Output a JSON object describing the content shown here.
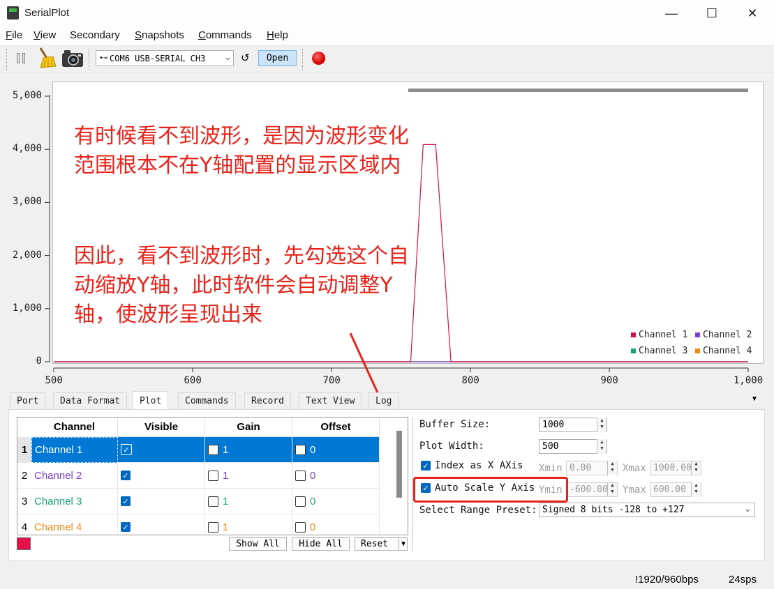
{
  "window": {
    "title": "SerialPlot",
    "minimize": "—",
    "maximize": "☐",
    "close": "✕"
  },
  "menu": [
    {
      "key": "F",
      "rest": "ile"
    },
    {
      "key": "V",
      "rest": "iew"
    },
    {
      "key": "",
      "rest": "Secondary"
    },
    {
      "key": "S",
      "rest": "napshots"
    },
    {
      "key": "C",
      "rest": "ommands"
    },
    {
      "key": "H",
      "rest": "elp"
    }
  ],
  "toolbar": {
    "port": "COM6 USB-SERIAL CH3",
    "refresh": "↺",
    "open_label": "Open",
    "icons": [
      "pause-icon",
      "clear-broom-icon",
      "snapshot-camera-icon",
      "usb-icon",
      "record-icon"
    ]
  },
  "plot": {
    "annotation_1": "有时候看不到波形，是因为波形变化范围根本不在Y轴配置的显示区域内",
    "annotation_2": "因此，看不到波形时，先勾选这个自动缩放Y轴，此时软件会自动调整Y轴，使波形呈现出来"
  },
  "chart_data": {
    "type": "line",
    "title": "",
    "xlabel": "",
    "ylabel": "",
    "xlim": [
      500,
      1000
    ],
    "ylim": [
      0,
      5000
    ],
    "x_ticks": [
      "500",
      "600",
      "700",
      "800",
      "900",
      "1,000"
    ],
    "y_ticks": [
      "0",
      "1,000",
      "2,000",
      "3,000",
      "4,000",
      "5,000"
    ],
    "grid": false,
    "legend_position": "bottom-right",
    "series": [
      {
        "name": "Channel 1",
        "color": "#d0104c",
        "x": [
          500,
          757,
          766,
          775,
          786,
          1000
        ],
        "y": [
          0,
          0,
          4090,
          4090,
          0,
          0
        ]
      },
      {
        "name": "Channel 2",
        "color": "#7a3fd0",
        "x": [
          500,
          1000
        ],
        "y": [
          0,
          0
        ]
      },
      {
        "name": "Channel 3",
        "color": "#1aa37a",
        "x": [
          500,
          1000
        ],
        "y": [
          0,
          0
        ]
      },
      {
        "name": "Channel 4",
        "color": "#f08a10",
        "x": [
          500,
          1000
        ],
        "y": [
          0,
          0
        ]
      }
    ]
  },
  "tabs": [
    "Port",
    "Data Format",
    "Plot",
    "Commands",
    "Record",
    "Text View",
    "Log"
  ],
  "active_tab": "Plot",
  "channel_table": {
    "headers": [
      "Channel",
      "Visible",
      "Gain",
      "Offset"
    ],
    "rows": [
      {
        "num": "1",
        "name": "Channel 1",
        "gain": "1",
        "offset": "0",
        "color": "#d0104c"
      },
      {
        "num": "2",
        "name": "Channel 2",
        "gain": "1",
        "offset": "0",
        "color": "#7a3fd0"
      },
      {
        "num": "3",
        "name": "Channel 3",
        "gain": "1",
        "offset": "0",
        "color": "#1aa37a"
      },
      {
        "num": "4",
        "name": "Channel 4",
        "gain": "1",
        "offset": "0",
        "color": "#f08a10"
      }
    ],
    "swatch_color": "#e8104c",
    "show_all": "Show All",
    "hide_all": "Hide All",
    "reset": "Reset"
  },
  "settings": {
    "buffer_size_label": "Buffer Size:",
    "buffer_size": "1000",
    "plot_width_label": "Plot Width:",
    "plot_width": "500",
    "index_x_label": "Index as X AXis",
    "xmin_label": "Xmin",
    "xmin": "0.00",
    "xmax_label": "Xmax",
    "xmax": "1000.00",
    "auto_scale_label": "Auto Scale Y Axis",
    "ymin_label": "Ymin",
    "ymin": "-600.00",
    "ymax_label": "Ymax",
    "ymax": "600.00",
    "range_preset_label": "Select Range Preset:",
    "range_preset": "Signed 8 bits -128 to +127"
  },
  "status": {
    "rate": "!1920/960bps",
    "sps": "24sps"
  }
}
